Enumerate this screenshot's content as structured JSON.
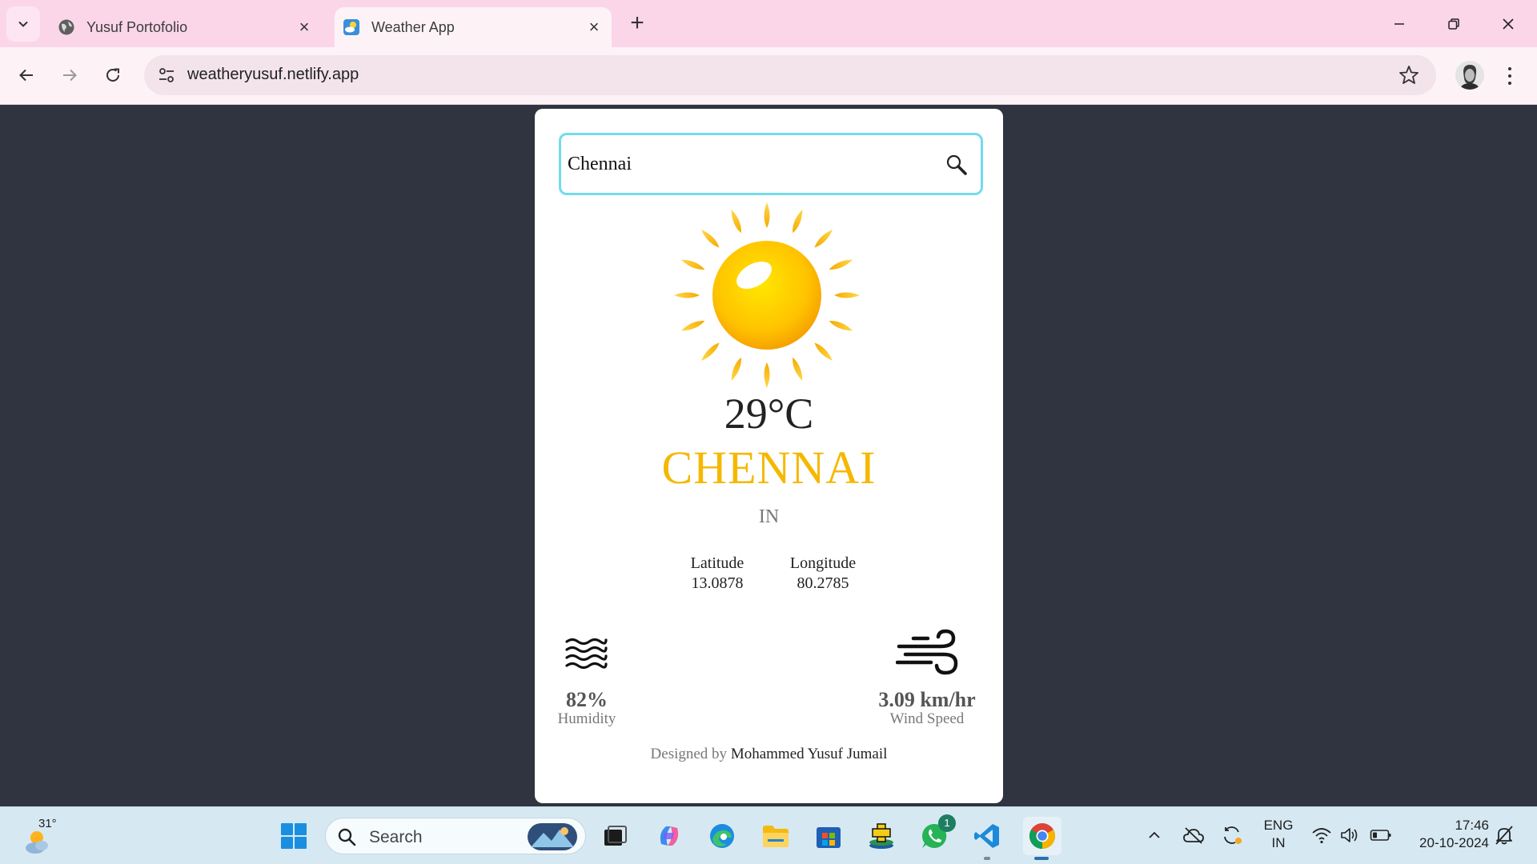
{
  "browser": {
    "tabs": [
      {
        "title": "Yusuf Portofolio",
        "icon": "globe-icon",
        "active": false
      },
      {
        "title": "Weather App",
        "icon": "weather-favicon-icon",
        "active": true
      }
    ],
    "new_tab_label": "+",
    "url": "weatheryusuf.netlify.app"
  },
  "app": {
    "search": {
      "value": "Chennai",
      "placeholder": ""
    },
    "weather_icon": "sun-icon",
    "temperature": "29°C",
    "city": "CHENNAI",
    "country": "IN",
    "latitude": {
      "label": "Latitude",
      "value": "13.0878"
    },
    "longitude": {
      "label": "Longitude",
      "value": "80.2785"
    },
    "humidity": {
      "value": "82%",
      "label": "Humidity",
      "icon": "humidity-waves-icon"
    },
    "wind": {
      "value": "3.09 km/hr",
      "label": "Wind Speed",
      "icon": "wind-icon"
    },
    "credit": {
      "prefix": "Designed by ",
      "author": "Mohammed Yusuf Jumail"
    },
    "colors": {
      "accent": "#f5b800",
      "search_border": "#73dbeb",
      "background": "#2f3440"
    }
  },
  "taskbar": {
    "weather_temp": "31°",
    "search_label": "Search",
    "whatsapp_badge": "1",
    "language": {
      "line1": "ENG",
      "line2": "IN"
    },
    "clock": {
      "time": "17:46",
      "date": "20-10-2024"
    }
  }
}
